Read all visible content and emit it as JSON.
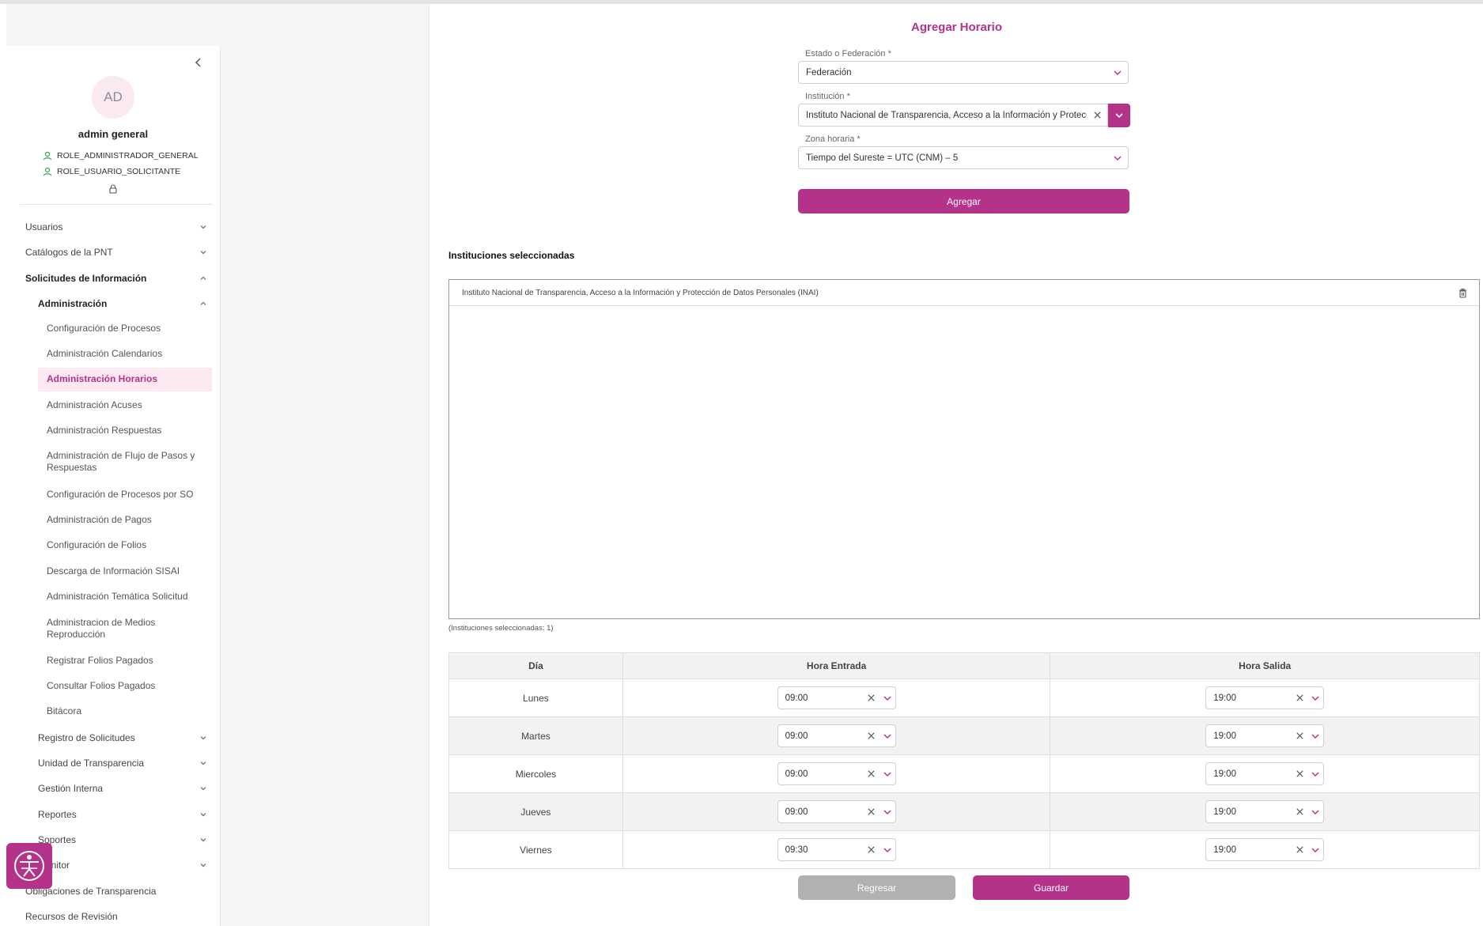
{
  "sidebar": {
    "avatar_initials": "AD",
    "user_name": "admin general",
    "roles": [
      "ROLE_ADMINISTRADOR_GENERAL",
      "ROLE_USUARIO_SOLICITANTE"
    ],
    "menu": {
      "usuarios": "Usuarios",
      "catalogos": "Catálogos de la PNT",
      "solicitudes": "Solicitudes de Información",
      "administracion": "Administración",
      "sub_items": [
        "Configuración de Procesos",
        "Administración Calendarios",
        "Administración Horarios",
        "Administración Acuses",
        "Administración Respuestas",
        "Administración de Flujo de Pasos y Respuestas",
        "Configuración de Procesos por SO",
        "Administración de Pagos",
        "Configuración de Folios",
        "Descarga de Información SISAI",
        "Administración Temática Solicitud",
        "Administracion de Medios Reproducción",
        "Registrar Folios Pagados",
        "Consultar Folios Pagados",
        "Bitácora"
      ],
      "registro": "Registro de Solicitudes",
      "unidad": "Unidad de Transparencia",
      "gestion": "Gestión Interna",
      "reportes": "Reportes",
      "soportes": "Soportes",
      "monitor": "Monitor",
      "obligaciones": "Obligaciones de Transparencia",
      "recursos": "Recursos de Revisión"
    }
  },
  "form": {
    "title": "Agregar Horario",
    "estado_label": "Estado o Federación *",
    "estado_value": "Federación",
    "institucion_label": "Institución *",
    "institucion_value": "Instituto Nacional de Transparencia, Acceso a la Información y Protección de Datos Personales (INAI)",
    "zona_label": "Zona horaria *",
    "zona_value": "Tiempo del Sureste = UTC (CNM) – 5",
    "agregar_label": "Agregar"
  },
  "selected": {
    "title": "Instituciones seleccionadas",
    "items": [
      "Instituto Nacional de Transparencia, Acceso a la Información y Protección de Datos Personales (INAI)"
    ],
    "count_text": "(Instituciones seleccionadas: 1)"
  },
  "schedule": {
    "headers": [
      "Día",
      "Hora Entrada",
      "Hora Salida"
    ],
    "rows": [
      {
        "day": "Lunes",
        "entrada": "09:00",
        "salida": "19:00"
      },
      {
        "day": "Martes",
        "entrada": "09:00",
        "salida": "19:00"
      },
      {
        "day": "Miercoles",
        "entrada": "09:00",
        "salida": "19:00"
      },
      {
        "day": "Jueves",
        "entrada": "09:00",
        "salida": "19:00"
      },
      {
        "day": "Viernes",
        "entrada": "09:30",
        "salida": "19:00"
      }
    ]
  },
  "actions": {
    "regresar": "Regresar",
    "guardar": "Guardar"
  },
  "colors": {
    "accent": "#b5328a",
    "active_bg": "#fde7f1",
    "gray_button": "#b1b1b1",
    "role_icon": "#2fa84f"
  }
}
